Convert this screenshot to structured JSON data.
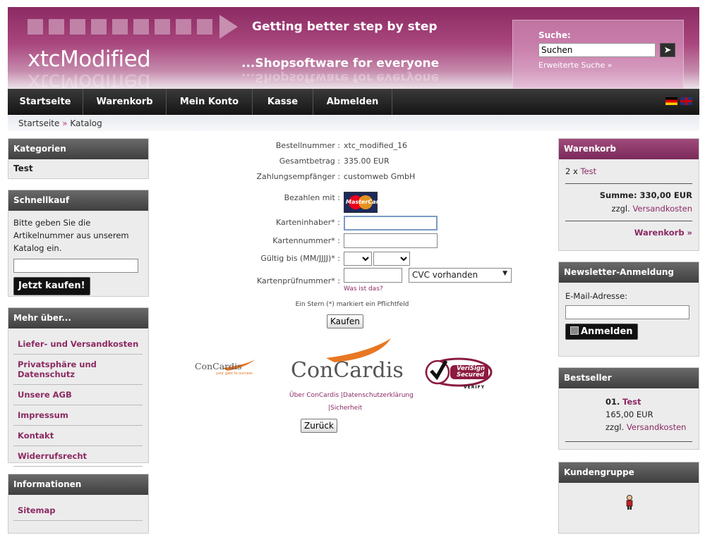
{
  "header": {
    "logo_text": "xtcModified",
    "slogan_line1": "Getting better step by step",
    "slogan_line2": "...Shopsoftware for everyone",
    "search": {
      "label": "Suche:",
      "value": "Suchen",
      "go_icon": "arrow-right-icon",
      "advanced_link": "Erweiterte Suche »"
    }
  },
  "nav": {
    "items": [
      {
        "label": "Startseite"
      },
      {
        "label": "Warenkorb"
      },
      {
        "label": "Mein Konto"
      },
      {
        "label": "Kasse"
      },
      {
        "label": "Abmelden"
      }
    ],
    "flags": [
      "flag-de-icon",
      "flag-en-icon"
    ]
  },
  "breadcrumb": {
    "home": "Startseite",
    "separator": "»",
    "current": "Katalog"
  },
  "left": {
    "categories": {
      "title": "Kategorien",
      "items": [
        "Test"
      ]
    },
    "quickbuy": {
      "title": "Schnellkauf",
      "text": "Bitte geben Sie die Artikelnummer aus unserem Katalog ein.",
      "button": "Jetzt kaufen!"
    },
    "more": {
      "title": "Mehr über...",
      "links": [
        "Liefer- und Versandkosten",
        "Privatsphäre und Datenschutz",
        "Unsere AGB",
        "Impressum",
        "Kontakt",
        "Widerrufsrecht"
      ]
    },
    "info": {
      "title": "Informationen",
      "links": [
        "Sitemap"
      ]
    }
  },
  "payment": {
    "order_number_label": "Bestellnummer :",
    "order_number": "xtc_modified_16",
    "total_label": "Gesamtbetrag :",
    "total": "335.00 EUR",
    "payee_label": "Zahlungsempfänger :",
    "payee": "customweb GmbH",
    "pay_with_label": "Bezahlen mit :",
    "card_brand": "MasterCard",
    "holder_label": "Karteninhaber* :",
    "number_label": "Kartennummer* :",
    "valid_label": "Gültig bis (MM/JJJJ)* :",
    "cvc_label": "Kartenprüfnummer* :",
    "cvc_select": "CVC vorhanden",
    "cvc_help": "Was ist das?",
    "required_note": "Ein Stern (*) markiert ein Pflichtfeld",
    "submit": "Kaufen",
    "concardis_name": "ConCardis",
    "concardis_tag": "your gate to success",
    "footer_links": "Über ConCardis |Datenschutzerklärung",
    "footer_link2": "|Sicherheit",
    "verisign_line1": "VeriSign",
    "verisign_line2": "Secured",
    "verisign_line3": "VERIFY",
    "back": "Zurück"
  },
  "right": {
    "cart": {
      "title": "Warenkorb",
      "item_qty": "2 x",
      "item_name": "Test",
      "sum": "Summe: 330,00 EUR",
      "shipping_prefix": "zzgl.",
      "shipping_link": "Versandkosten",
      "cart_link": "Warenkorb »"
    },
    "newsletter": {
      "title": "Newsletter-Anmeldung",
      "email_label": "E-Mail-Adresse:",
      "button": "Anmelden"
    },
    "bestseller": {
      "title": "Bestseller",
      "rank": "01.",
      "name": "Test",
      "price": "165,00 EUR",
      "shipping_prefix": "zzgl.",
      "shipping_link": "Versandkosten"
    },
    "customer_group": {
      "title": "Kundengruppe",
      "icon": "guest-user-icon"
    }
  },
  "colors": {
    "brand": "#8b2a62",
    "nav_bg": "#1e1e1e",
    "box_head": "#555555"
  }
}
